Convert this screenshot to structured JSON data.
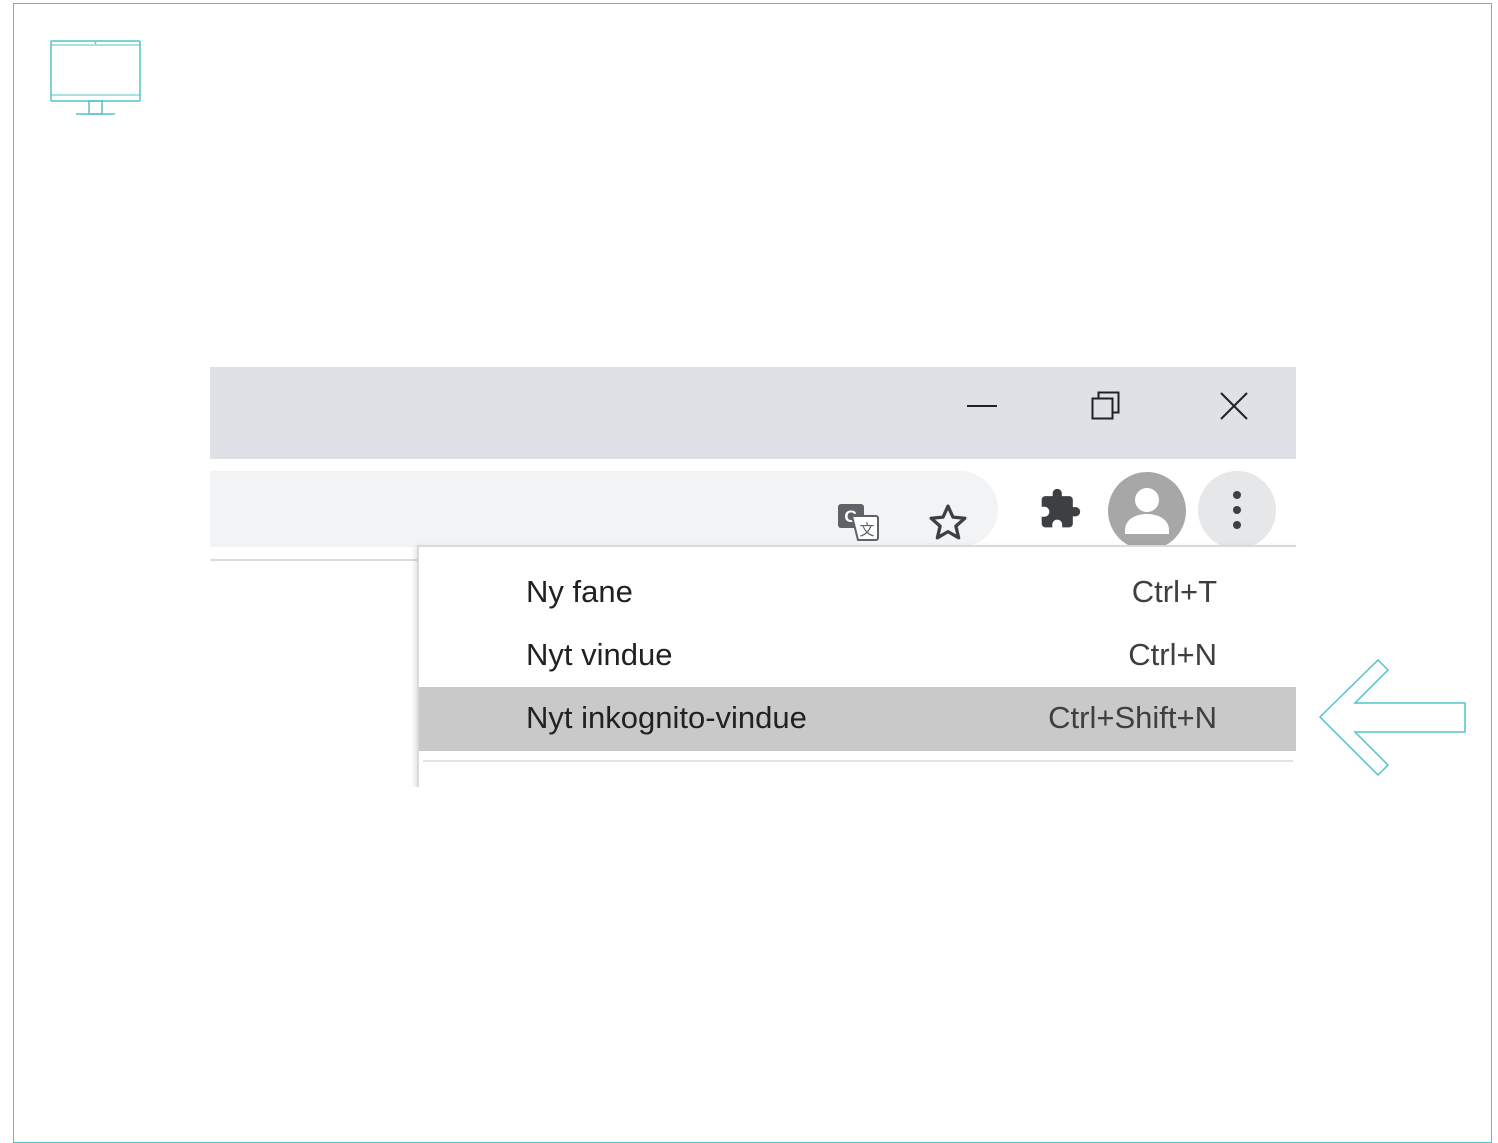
{
  "colors": {
    "accent": "#52c4c6",
    "titlebar": "#dee1e6",
    "highlight": "#c9c9c9"
  },
  "header": {
    "icon": "monitor-icon"
  },
  "window_controls": {
    "minimize_icon": "minimize-icon",
    "restore_icon": "restore-icon",
    "close_icon": "close-icon"
  },
  "toolbar": {
    "translate_icon": "translate-icon",
    "bookmark_icon": "star-icon",
    "extensions_icon": "puzzle-icon",
    "profile_icon": "avatar-icon",
    "menu_icon": "more-vert-icon"
  },
  "menu": {
    "items": [
      {
        "label": "Ny fane",
        "shortcut": "Ctrl+T",
        "highlighted": false
      },
      {
        "label": "Nyt vindue",
        "shortcut": "Ctrl+N",
        "highlighted": false
      },
      {
        "label": "Nyt inkognito-vindue",
        "shortcut": "Ctrl+Shift+N",
        "highlighted": true
      }
    ]
  },
  "pointer": {
    "icon": "arrow-left-icon"
  }
}
